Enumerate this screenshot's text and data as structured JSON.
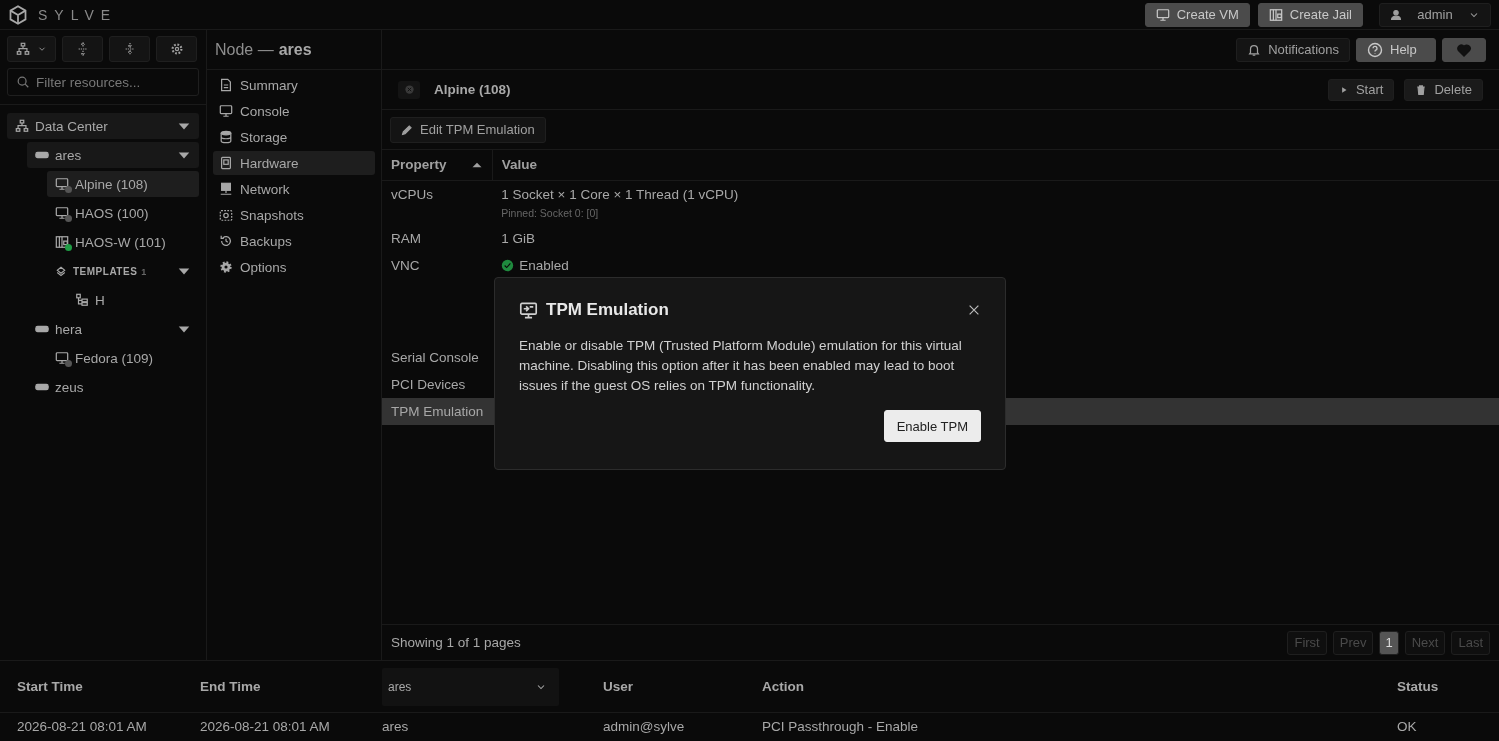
{
  "header": {
    "brand": "SYLVE",
    "actions": [
      {
        "label": "Create VM"
      },
      {
        "label": "Create Jail"
      }
    ],
    "user": "admin"
  },
  "sidebar": {
    "filter": {
      "placeholder": "Filter resources..."
    },
    "tree": [
      {
        "label": "Data Center",
        "kind": "datacenter",
        "expanded": true,
        "active": true,
        "children": [
          {
            "label": "ares",
            "kind": "node",
            "expanded": true,
            "active": true,
            "children": [
              {
                "label": "Alpine (108)",
                "kind": "vm",
                "color": "#555555",
                "selected": true
              },
              {
                "label": "HAOS (100)",
                "kind": "vm",
                "color": "#555555",
                "selected": false
              },
              {
                "label": "HAOS-W (101)",
                "kind": "jail",
                "color": "#1f9d45",
                "selected": false
              },
              {
                "label": "TEMPLATES",
                "kind": "templates",
                "count": "1",
                "expanded": true,
                "children": [
                  {
                    "label": "H",
                    "kind": "template",
                    "selected": false
                  }
                ]
              }
            ]
          },
          {
            "label": "hera",
            "kind": "node",
            "expanded": true,
            "active": false,
            "children": [
              {
                "label": "Fedora (109)",
                "kind": "vm",
                "color": "#555555",
                "selected": false
              }
            ]
          },
          {
            "label": "zeus",
            "kind": "node",
            "active": false
          }
        ]
      }
    ]
  },
  "nav": {
    "title": "Node —",
    "node": "ares",
    "items": [
      {
        "label": "Summary",
        "selected": false
      },
      {
        "label": "Console",
        "selected": false
      },
      {
        "label": "Storage",
        "selected": false
      },
      {
        "label": "Hardware",
        "selected": true
      },
      {
        "label": "Network",
        "selected": false
      },
      {
        "label": "Snapshots",
        "selected": false
      },
      {
        "label": "Backups",
        "selected": false
      },
      {
        "label": "Options",
        "selected": false
      }
    ]
  },
  "toolbar": {
    "notifications": "Notifications",
    "help": "Help"
  },
  "panel": {
    "tab": "Alpine (108)",
    "actions": [
      {
        "label": "Start"
      },
      {
        "label": "Delete"
      }
    ],
    "edit_button": "Edit TPM Emulation",
    "table": {
      "columns": [
        {
          "label": "Property",
          "sorted": true
        },
        {
          "label": "Value",
          "sorted": false
        }
      ],
      "rows": [
        {
          "property": "vCPUs",
          "value": "1 Socket × 1 Core × 1 Thread (1 vCPU)",
          "note": "Pinned: Socket 0: [0]",
          "kind": "text",
          "selected": false
        },
        {
          "property": "RAM",
          "value": "1 GiB",
          "kind": "text",
          "selected": false
        },
        {
          "property": "VNC",
          "value": "Enabled",
          "kind": "status",
          "selected": false
        },
        {
          "property": "Serial Console",
          "kind": "text",
          "selected": false
        },
        {
          "property": "PCI Devices",
          "kind": "text",
          "selected": false
        },
        {
          "property": "TPM Emulation",
          "kind": "text",
          "selected": true
        }
      ]
    },
    "footer": "Showing 1 of 1 pages",
    "pager": [
      {
        "label": "First",
        "kind": "nav"
      },
      {
        "label": "Prev",
        "kind": "nav"
      },
      {
        "label": "1",
        "kind": "page",
        "selected": true
      },
      {
        "label": "Next",
        "kind": "nav"
      },
      {
        "label": "Last",
        "kind": "nav"
      }
    ]
  },
  "tasks": {
    "columns": [
      {
        "label": "Start Time",
        "kind": "text"
      },
      {
        "label": "End Time",
        "kind": "text"
      },
      {
        "label": "ares",
        "kind": "select"
      },
      {
        "label": "User",
        "kind": "text"
      },
      {
        "label": "Action",
        "kind": "text"
      },
      {
        "label": "Status",
        "kind": "text"
      }
    ],
    "rows": [
      [
        "2026-08-21 08:01 AM",
        "2026-08-21 08:01 AM",
        "ares",
        "admin@sylve",
        "PCI Passthrough - Enable",
        "OK"
      ]
    ]
  },
  "dialog": {
    "title": "TPM Emulation",
    "body": "Enable or disable TPM (Trusted Platform Module) emulation for this virtual machine. Disabling this option after it has been enabled may lead to boot issues if the guest OS relies on TPM functionality.",
    "button": "Enable TPM"
  }
}
